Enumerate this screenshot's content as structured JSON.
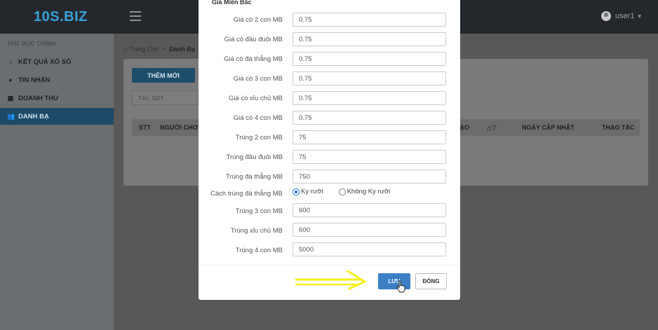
{
  "app": {
    "brand": "10S.BIZ",
    "user": "user1",
    "caret": "▾"
  },
  "sidebar": {
    "title": "THƯ MỤC CHÍNH",
    "items": [
      {
        "label": "KẾT QUẢ XỔ SỐ",
        "icon": "⌂"
      },
      {
        "label": "TIN NHẮN",
        "icon": "●"
      },
      {
        "label": "DOANH THU",
        "icon": "▦"
      },
      {
        "label": "DANH BẠ",
        "icon": "👥"
      }
    ]
  },
  "main": {
    "breadcrumb": {
      "home": "Trang Chủ",
      "separator": ">",
      "current": "Danh Bạ"
    },
    "add_button": "THÊM MỚI",
    "search_placeholder": "Tên, SDT",
    "table_headers": {
      "stt": "STT",
      "nguoi_choi": "NGƯỜI CHƠ",
      "tao": "TẠO",
      "sort": "△▽",
      "ngay_cap_nhat": "NGÀY CẬP NHẬT",
      "thao_tac": "THAO TÁC"
    }
  },
  "modal": {
    "section_title": "Giá Miền Bắc",
    "fields": [
      {
        "label": "Giá cò 2 con MB",
        "value": "0.75"
      },
      {
        "label": "Giá cò đầu đuôi MB",
        "value": "0.75"
      },
      {
        "label": "Giá cò đá thẳng MB",
        "value": "0.75"
      },
      {
        "label": "Giá cò 3 con MB",
        "value": "0.75"
      },
      {
        "label": "Giá cò xỉu chủ MB",
        "value": "0.75"
      },
      {
        "label": "Giá cò 4 con MB",
        "value": "0.75"
      },
      {
        "label": "Trúng 2 con MB",
        "value": "75"
      },
      {
        "label": "Trúng đầu đuôi MB",
        "value": "75"
      },
      {
        "label": "Trúng đá thẳng MB",
        "value": "750"
      }
    ],
    "radio_group": {
      "label": "Cách trúng đá thẳng MB",
      "options": [
        {
          "label": "Ky rưỡi",
          "selected": true
        },
        {
          "label": "Không Ky rưỡi",
          "selected": false
        }
      ]
    },
    "fields_after": [
      {
        "label": "Trúng 3 con MB",
        "value": "600"
      },
      {
        "label": "Trúng xỉu chủ MB",
        "value": "600"
      },
      {
        "label": "Trúng 4 con MB",
        "value": "5000"
      }
    ],
    "save_button": "LƯU",
    "close_button": "ĐÓNG"
  },
  "colors": {
    "accent": "#3c7fc4",
    "brand": "#3aa0d8",
    "annotation_arrow": "#f5f01a"
  }
}
